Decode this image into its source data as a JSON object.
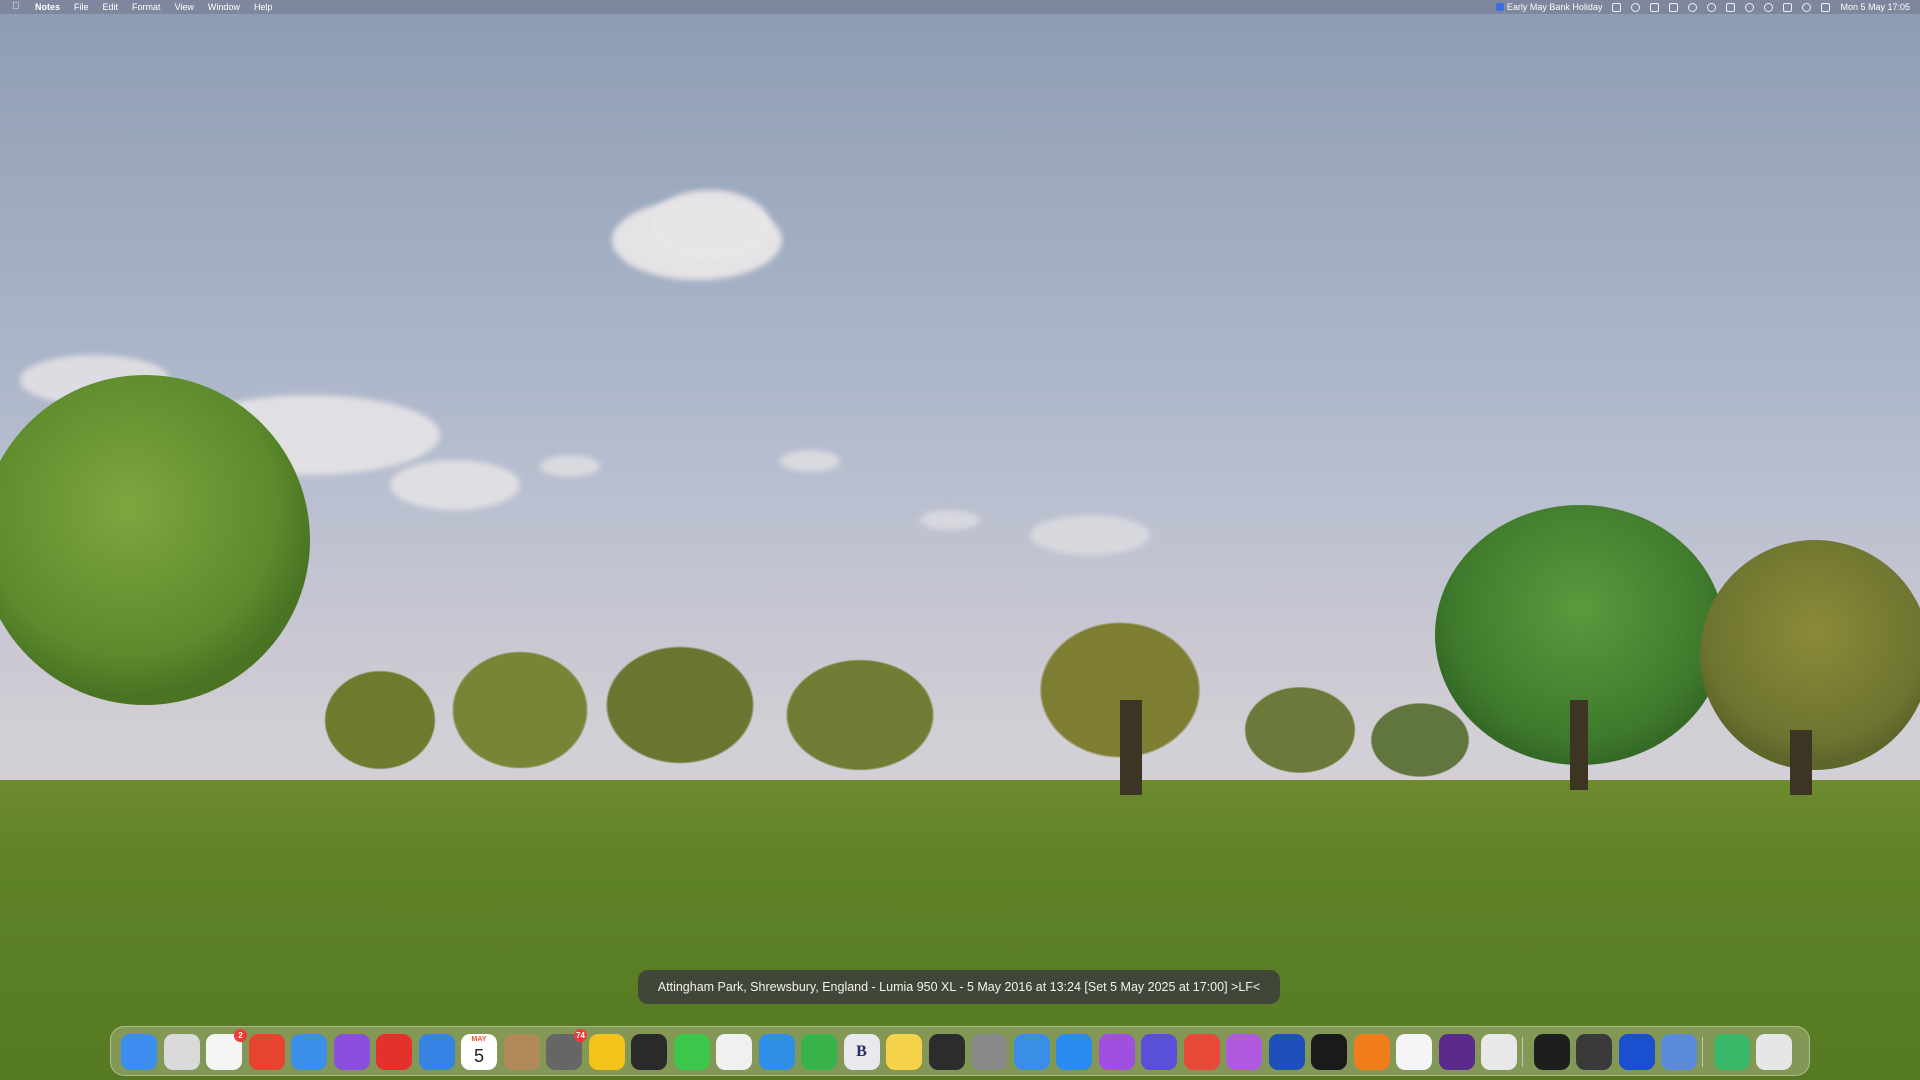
{
  "menubar": {
    "app_name": "Notes",
    "menus": [
      "File",
      "Edit",
      "Format",
      "View",
      "Window",
      "Help"
    ],
    "event_label": "Early May Bank Holiday",
    "datetime": "Mon 5 May  17:05",
    "status_icons": [
      "notes-status-icon",
      "pin-icon",
      "shield-icon",
      "bin-icon",
      "bluetooth-icon",
      "spotify-icon",
      "malwarebytes-m-icon",
      "headphones-icon",
      "sync-icon",
      "screen-mirror-icon",
      "time-machine-icon",
      "control-centre-icon"
    ]
  },
  "caption": {
    "text": "Attingham Park, Shrewsbury, England - Lumia 950 XL - 5 May 2016 at 13:24  [Set 5 May 2025 at 17:00]  >LF<"
  },
  "dock": {
    "apps": [
      {
        "name": "finder",
        "color": "#3d8df0"
      },
      {
        "name": "launchpad",
        "color": "#d9d9d9"
      },
      {
        "name": "reminders-check",
        "color": "#f5f5f5",
        "badge": "2"
      },
      {
        "name": "red-app",
        "color": "#e8432f"
      },
      {
        "name": "mail",
        "color": "#3a8fe8"
      },
      {
        "name": "calendar-grid",
        "color": "#8b4fe0"
      },
      {
        "name": "vivaldi",
        "color": "#e6302c"
      },
      {
        "name": "safari",
        "color": "#3584e4"
      },
      {
        "name": "calendar",
        "color": "#ffffff",
        "month": "MAY",
        "day": "5"
      },
      {
        "name": "notebook",
        "color": "#b08a5b"
      },
      {
        "name": "star-app",
        "color": "#666666",
        "badge": "74"
      },
      {
        "name": "reeder-bolt",
        "color": "#f2c31b"
      },
      {
        "name": "chat-bubbles",
        "color": "#2a2a2a"
      },
      {
        "name": "messages",
        "color": "#3cc84a"
      },
      {
        "name": "photos",
        "color": "#f0f0f0"
      },
      {
        "name": "clock-compass",
        "color": "#2f8fe6"
      },
      {
        "name": "numbers",
        "color": "#38b34a"
      },
      {
        "name": "bbedit",
        "color": "#e8e8ee",
        "glyph": "B"
      },
      {
        "name": "notes",
        "color": "#f4d24a"
      },
      {
        "name": "vectorize",
        "color": "#2c2c2c"
      },
      {
        "name": "system-settings",
        "color": "#8a8a8a"
      },
      {
        "name": "xcode-tools",
        "color": "#3a8ee6"
      },
      {
        "name": "app-store",
        "color": "#2a8cf0"
      },
      {
        "name": "podcasts",
        "color": "#a04fe0"
      },
      {
        "name": "shortcuts",
        "color": "#5a4fd8"
      },
      {
        "name": "screens",
        "color": "#e84a3a"
      },
      {
        "name": "pastebot",
        "color": "#b05ae0"
      },
      {
        "name": "shield-app",
        "color": "#1f4fb8"
      },
      {
        "name": "infuse",
        "color": "#1a1a1a"
      },
      {
        "name": "vlc",
        "color": "#f07d1a"
      },
      {
        "name": "chatgpt",
        "color": "#f5f5f5"
      },
      {
        "name": "music-sampler",
        "color": "#5a2a8a"
      },
      {
        "name": "iphone-mirroring",
        "color": "#e8e8e8"
      },
      {
        "name": "terminal",
        "color": "#1e1e1e"
      },
      {
        "name": "sketch-tool",
        "color": "#3a3a3a"
      },
      {
        "name": "malwarebytes",
        "color": "#1a4fd0"
      },
      {
        "name": "preview",
        "color": "#5a8ad8"
      },
      {
        "name": "downloads",
        "color": "#3ab86a"
      },
      {
        "name": "trash",
        "color": "#e6e6e6"
      }
    ]
  }
}
